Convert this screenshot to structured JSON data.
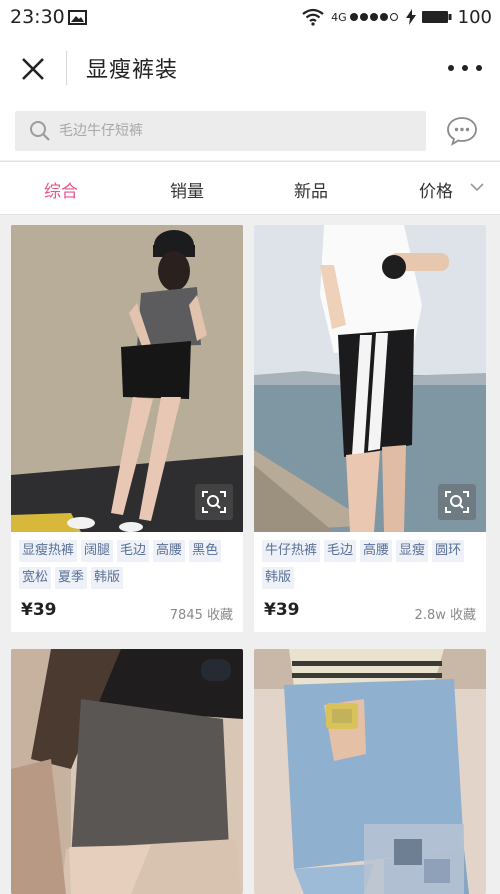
{
  "status_bar": {
    "time": "23:30",
    "network": "4G",
    "battery": "100"
  },
  "nav": {
    "title": "显瘦裤装"
  },
  "search": {
    "placeholder": "毛边牛仔短裤"
  },
  "sort_tabs": [
    {
      "label": "综合",
      "active": true
    },
    {
      "label": "销量",
      "active": false
    },
    {
      "label": "新品",
      "active": false
    },
    {
      "label": "价格",
      "active": false
    }
  ],
  "colors": {
    "accent": "#e8548c",
    "tag_text": "#5a6f95",
    "tag_bg": "#eef2f8"
  },
  "products": [
    {
      "tags": [
        "显瘦热裤",
        "阔腿",
        "毛边",
        "高腰",
        "黑色",
        "宽松",
        "夏季",
        "韩版"
      ],
      "price": "¥39",
      "favorites": "7845 收藏"
    },
    {
      "tags": [
        "牛仔热裤",
        "毛边",
        "高腰",
        "显瘦",
        "圆环",
        "韩版"
      ],
      "price": "¥39",
      "favorites": "2.8w 收藏"
    },
    {
      "tags": [],
      "price": "",
      "favorites": ""
    },
    {
      "tags": [],
      "price": "",
      "favorites": ""
    }
  ]
}
